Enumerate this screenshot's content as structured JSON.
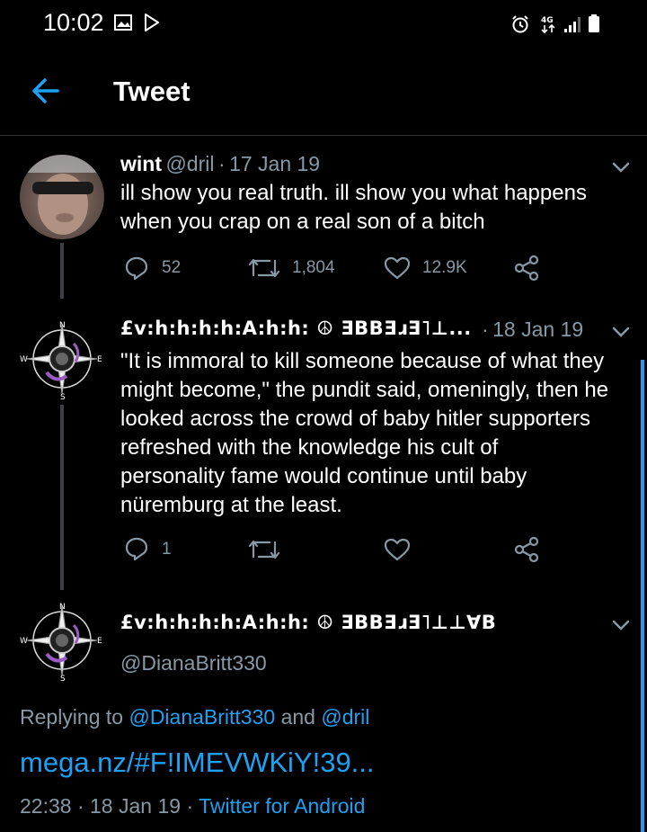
{
  "status_bar": {
    "time": "10:02"
  },
  "header": {
    "title": "Tweet"
  },
  "tweet1": {
    "author_name": "wint",
    "handle": "@dril",
    "separator": "·",
    "date": "17 Jan 19",
    "text_line1": "ill show you real truth. ill show you what happens",
    "text_line2": "when you crap on a real son of a bitch",
    "replies": "52",
    "retweets": "1,804",
    "likes": "12.9K"
  },
  "tweet2": {
    "author_name": "£v:h:h:h:h:A:h:h: ☮ ƎBBƎɹƎ˥⊥...",
    "separator": "·",
    "date": "18 Jan 19",
    "lines": [
      "\"It is immoral to kill someone because of what they",
      "might become,\" the pundit said, omeningly, then he",
      "looked across the crowd of baby hitler supporters",
      "refreshed with the knowledge his cult of",
      "personality fame would continue until baby",
      "nüremburg at the least."
    ],
    "replies": "1"
  },
  "main_tweet": {
    "author_name": "£v:h:h:h:h:A:h:h: ☮ ƎBBƎɹƎ˥⊥⊥∀B",
    "handle": "@DianaBritt330",
    "replying_prefix": "Replying to",
    "replying_user1": "@DianaBritt330",
    "replying_and": "and",
    "replying_user2": "@dril",
    "link": "mega.nz/#F!IMEVWKiY!39...",
    "time": "22:38",
    "separator": "·",
    "date": "18 Jan 19",
    "separator2": "·",
    "client": "Twitter for Android"
  },
  "colors": {
    "accent": "#1da1f2",
    "muted": "#8899a6",
    "bg": "#000000",
    "divider": "#2f3336"
  }
}
